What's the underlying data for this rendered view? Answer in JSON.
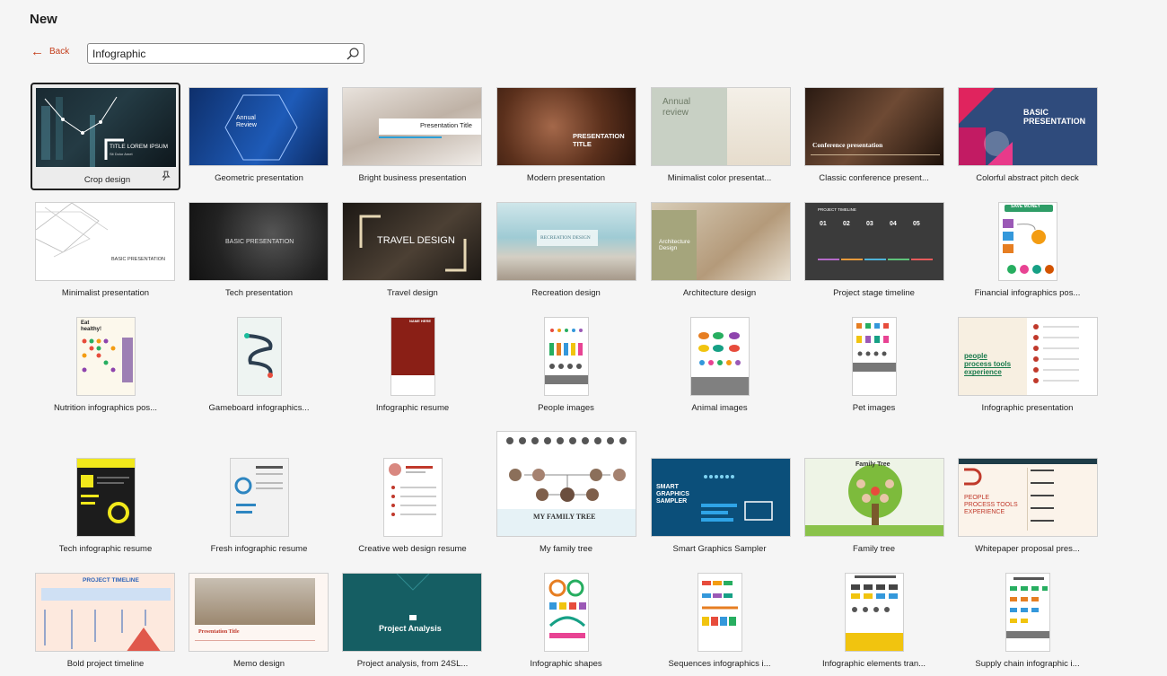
{
  "header": {
    "title": "New",
    "back_label": "Back"
  },
  "search": {
    "value": "Infographic",
    "icon": "search-icon"
  },
  "templates": [
    {
      "label": "Crop design",
      "thumb_text": "TITLE LOREM IPSUM",
      "thumb_sub": "Sit Dolor Amet"
    },
    {
      "label": "Geometric presentation",
      "thumb_text": "Annual Review"
    },
    {
      "label": "Bright business presentation",
      "thumb_text": "Presentation Title"
    },
    {
      "label": "Modern presentation",
      "thumb_text": "PRESENTATION TITLE"
    },
    {
      "label": "Minimalist color presentat...",
      "thumb_text": "Annual review"
    },
    {
      "label": "Classic conference present...",
      "thumb_text": "Conference presentation"
    },
    {
      "label": "Colorful abstract pitch deck",
      "thumb_text": "BASIC PRESENTATION"
    },
    {
      "label": "Minimalist presentation",
      "thumb_text": "BASIC PRESENTATION"
    },
    {
      "label": "Tech presentation",
      "thumb_text": "BASIC PRESENTATION"
    },
    {
      "label": "Travel design",
      "thumb_text": "TRAVEL DESIGN"
    },
    {
      "label": "Recreation design",
      "thumb_text": "RECREATION DESIGN"
    },
    {
      "label": "Architecture design",
      "thumb_text": "Architecture Design"
    },
    {
      "label": "Project stage timeline",
      "thumb_text": "PROJECT TIMELINE",
      "steps": [
        "01",
        "02",
        "03",
        "04",
        "05"
      ]
    },
    {
      "label": "Financial infographics pos...",
      "thumb_text": "SAVE MONEY"
    },
    {
      "label": "Nutrition infographics pos...",
      "thumb_text": "Eat healthy!"
    },
    {
      "label": "Gameboard infographics..."
    },
    {
      "label": "Infographic resume",
      "thumb_text": "NAME HERE"
    },
    {
      "label": "People images"
    },
    {
      "label": "Animal images"
    },
    {
      "label": "Pet images"
    },
    {
      "label": "Infographic presentation",
      "thumb_text": "people process tools experience"
    },
    {
      "label": "Tech infographic resume"
    },
    {
      "label": "Fresh infographic resume"
    },
    {
      "label": "Creative web design resume"
    },
    {
      "label": "My family tree",
      "thumb_text": "MY FAMILY TREE"
    },
    {
      "label": "Smart Graphics Sampler",
      "thumb_text": "SMART GRAPHICS SAMPLER"
    },
    {
      "label": "Family tree",
      "thumb_text": "Family Tree"
    },
    {
      "label": "Whitepaper proposal pres...",
      "thumb_text": "PEOPLE PROCESS TOOLS EXPERIENCE"
    },
    {
      "label": "Bold project timeline",
      "thumb_text": "PROJECT TIMELINE"
    },
    {
      "label": "Memo design",
      "thumb_text": "Presentation Title"
    },
    {
      "label": "Project analysis, from 24SL...",
      "thumb_text": "Project Analysis"
    },
    {
      "label": "Infographic shapes"
    },
    {
      "label": "Sequences infographics i..."
    },
    {
      "label": "Infographic elements tran..."
    },
    {
      "label": "Supply chain infographic i..."
    }
  ],
  "colors": {
    "accent": "#c43e1c",
    "selected_border": "#1f1f1f",
    "background": "#f5f5f5"
  }
}
